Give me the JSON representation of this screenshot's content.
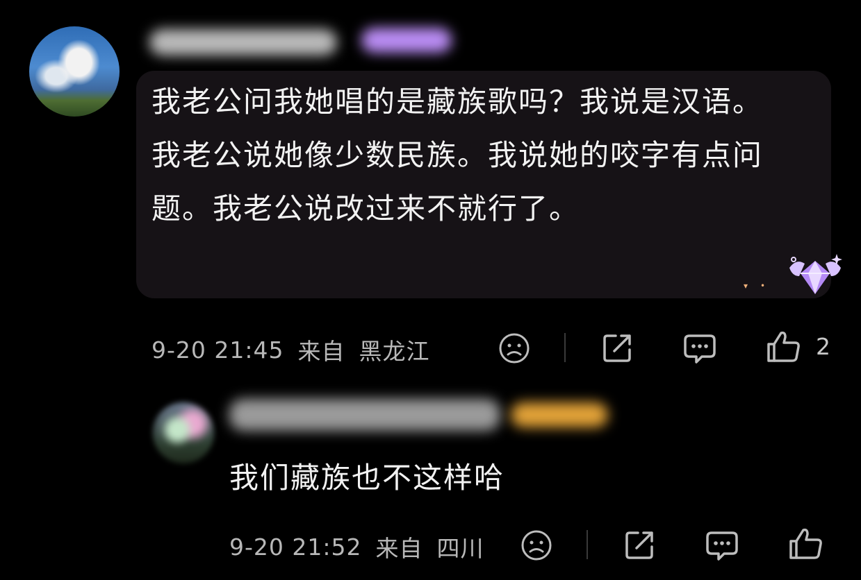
{
  "comment": {
    "text": "我老公问我她唱的是藏族歌吗？我说是汉语。我老公说她像少数民族。我说她的咬字有点问题。我老公说改过来不就行了。",
    "timestamp": "9-20 21:45",
    "from_label": "来自",
    "location": "黑龙江",
    "like_count": "2"
  },
  "reply": {
    "text": "我们藏族也不这样哈",
    "timestamp": "9-20 21:52",
    "from_label": "来自",
    "location": "四川"
  },
  "icons": [
    "sad-face-icon",
    "share-icon",
    "comment-icon",
    "thumbs-up-icon",
    "diamond-badge-icon"
  ],
  "colors": {
    "background": "#000000",
    "bubble": "#161216",
    "badge": "#c9a4ff"
  }
}
